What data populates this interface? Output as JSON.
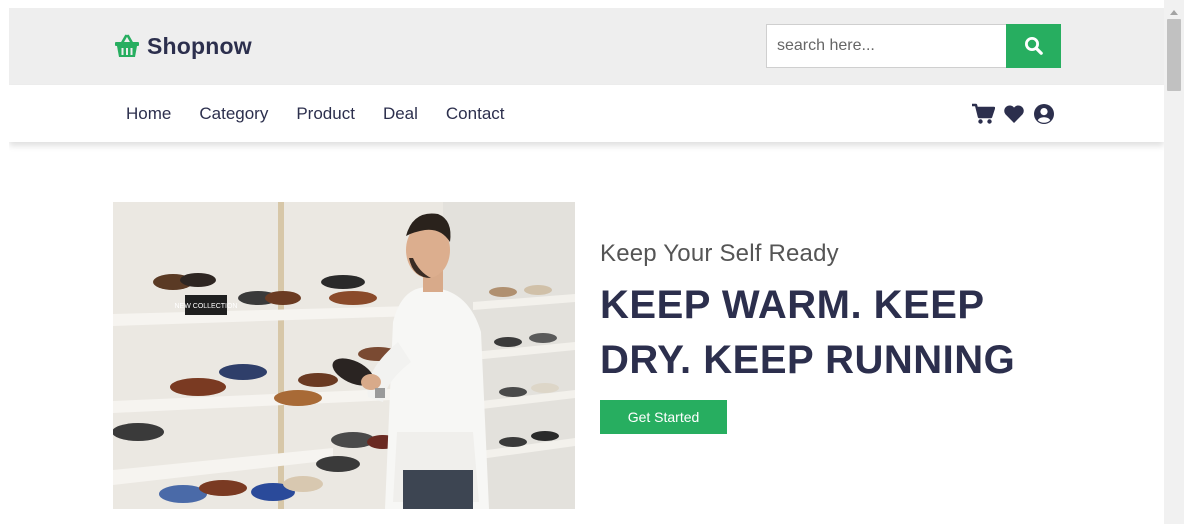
{
  "header": {
    "logo_text": "Shopnow",
    "logo_icon": "shopping-basket-icon",
    "search": {
      "placeholder": "search here...",
      "value": "",
      "button_icon": "search-icon"
    }
  },
  "nav": {
    "links": [
      "Home",
      "Category",
      "Product",
      "Deal",
      "Contact"
    ],
    "icons": [
      "shopping-cart-icon",
      "heart-icon",
      "user-circle-icon"
    ]
  },
  "hero": {
    "image": "man-holding-shoe-in-shoe-store-photo",
    "subtitle": "Keep Your Self Ready",
    "title": "KEEP WARM. KEEP DRY. KEEP RUNNING",
    "button_label": "Get Started",
    "sign_text": "NEW COLLECTION"
  },
  "colors": {
    "accent": "#27ae60",
    "text_dark": "#2c2f4d",
    "header_bg": "#eeeeee"
  }
}
